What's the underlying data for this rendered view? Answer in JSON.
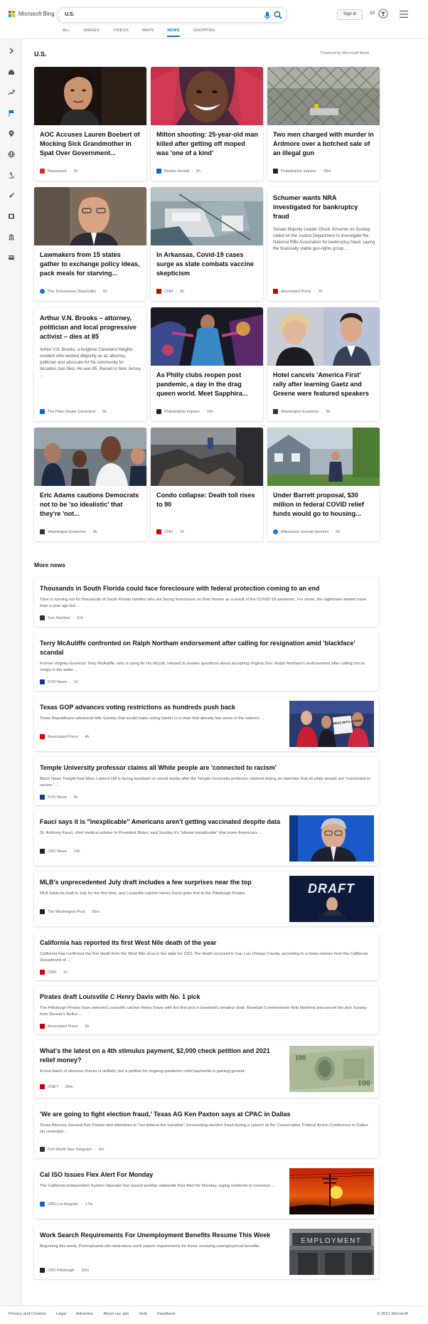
{
  "header": {
    "logo_text": "Microsoft Bing",
    "search_value": "U.S.",
    "signin_label": "Sign in",
    "reward_points": "10",
    "tabs": [
      "ALL",
      "IMAGES",
      "VIDEOS",
      "MAPS",
      "NEWS",
      "SHOPPING"
    ],
    "active_tab": "NEWS"
  },
  "sidebar": {
    "icons": [
      "expand-arrow-icon",
      "home-icon",
      "trending-icon",
      "flag-icon",
      "location-pin-icon",
      "globe-icon",
      "microscope-icon",
      "rocket-icon",
      "film-icon",
      "bank-icon",
      "credit-card-icon"
    ]
  },
  "section": {
    "title": "U.S.",
    "powered_by": "Powered by Microsoft News"
  },
  "top_stories": [
    {
      "title": "AOC Accuses Lauren Boebert of Mocking Sick Grandmother in Spat Over Government...",
      "source": "Newsweek",
      "time": "3h",
      "source_color": "#d32f2f"
    },
    {
      "title": "Milton shooting: 25-year-old man killed after getting off moped was 'one of a kind'",
      "source": "Boston Herald",
      "time": "2h",
      "source_color": "#1565c0"
    },
    {
      "title": "Two men charged with murder in Ardmore over a botched sale of an illegal gun",
      "source": "Philadelphia Inquirer",
      "time": "35m",
      "source_color": "#222222"
    },
    {
      "title": "Lawmakers from 15 states gather to exchange policy ideas, pack meals for starving...",
      "source": "The Tennessean (Nashville)",
      "time": "6h",
      "source_color": "#1976d2"
    },
    {
      "title": "In Arkansas, Covid-19 cases surge as state combats vaccine skepticism",
      "source": "CNN",
      "time": "2h",
      "source_color": "#cc0000"
    },
    {
      "title": "Schumer wants NRA investigated for bankruptcy fraud",
      "summary": "Senate Majority Leader Chuck Schumer on Sunday called on the Justice Department to investigate the National Rifle Association for bankruptcy fraud, saying the financially stable gun-rights group ...",
      "source": "Associated Press",
      "time": "7h",
      "source_color": "#cc0000"
    },
    {
      "title": "Arthur V.N. Brooks – attorney, politician and local progressive activist – dies at 85",
      "summary": "Arthur V.N. Brooks, a longtime Cleveland Heights resident who worked diligently as an attorney, politician and advocate for his community for decades, has died. He was 85. Raised in New Jersey, ...",
      "source": "The Plain Dealer Cleveland",
      "time": "5h",
      "source_color": "#1565c0"
    },
    {
      "title": "As Philly clubs reopen post pandemic, a day in the drag queen world. Meet Sapphira...",
      "source": "Philadelphia Inquirer",
      "time": "16h",
      "source_color": "#222222"
    },
    {
      "title": "Hotel cancels 'America First' rally after learning Gaetz and Greene were featured speakers",
      "source": "Washington Examiner",
      "time": "5h",
      "source_color": "#333333"
    },
    {
      "title": "Eric Adams cautions Democrats not to be 'so idealistic' that they're 'not...",
      "source": "Washington Examiner",
      "time": "9h",
      "source_color": "#333333"
    },
    {
      "title": "Condo collapse: Death toll rises to 90",
      "source": "CNN",
      "time": "7h",
      "source_color": "#cc0000"
    },
    {
      "title": "Under Barrett proposal, $30 million in federal COVID relief funds would go to housing...",
      "source": "Milwaukee Journal-Sentinel",
      "time": "3h",
      "source_color": "#1976d2"
    }
  ],
  "more_news": {
    "title": "More news",
    "items": [
      {
        "title": "Thousands in South Florida could face foreclosure with federal protection coming to an end",
        "summary": "Time is running out for thousands of South Florida families who are facing foreclosure on their homes as a result of the COVID-19 pandemic. For some, the nightmare started more than a year ago but ...",
        "source": "Sun Sentinel",
        "time": "11h",
        "source_color": "#333333"
      },
      {
        "title": "Terry McAuliffe confronted on Ralph Northam endorsement after calling for resignation amid 'blackface' scandal",
        "summary": "Former Virginia Governor Terry McAuliffe, who is vying for his old job, refused to answer questions about accepting Virginia Gov. Ralph Northam's endorsement after calling him to resign in the wake ...",
        "source": "FOX News",
        "time": "1h",
        "source_color": "#1a3a8a"
      },
      {
        "title": "Texas GOP advances voting restrictions as hundreds push back",
        "summary": "Texas Republicans advanced bills Sunday that would make voting harder in a state that already has some of the nation's ...",
        "source": "Associated Press",
        "time": "4h",
        "source_color": "#cc0000"
      },
      {
        "title": "Temple University professor claims all White people are 'connected to racism'",
        "summary": "Black News Tonight host Marc Lamont Hill is facing backlash on social media after the Temple University professor claimed during an interview that all white people are \"connected to racism.\" ...",
        "source": "FOX News",
        "time": "4h",
        "source_color": "#1a3a8a"
      },
      {
        "title": "Fauci says it is \"inexplicable\" Americans aren't getting vaccinated despite data",
        "summary": "Dr. Anthony Fauci, chief medical adviser to President Biden, said Sunday it's \"almost inexplicable\" that some Americans ...",
        "source": "CBS News",
        "time": "10h",
        "source_color": "#222222"
      },
      {
        "title": "MLB's unprecedented July draft includes a few surprises near the top",
        "summary": "MLB holds its draft in July for the first time, and Louisville catcher Henry Davis goes first to the Pittsburgh Pirates.",
        "source": "The Washington Post",
        "time": "50m",
        "source_color": "#222222"
      },
      {
        "title": "California has reported its first West Nile death of the year",
        "summary": "California has confirmed the first death from the West Nile virus in the state for 2021.The death occurred in San Luis Obispo County, according to a news release from the California Department of ...",
        "source": "CNN",
        "time": "1h",
        "source_color": "#cc0000"
      },
      {
        "title": "Pirates draft Louisville C Henry Davis with No. 1 pick",
        "summary": "The Pittsburgh Pirates have selected Louisville catcher Henry Davis with the first pick in baseball's amateur draft. Baseball Commissioner Rob Manfred announced the pick Sunday from Denver's Bellco ...",
        "source": "Associated Press",
        "time": "2h",
        "source_color": "#cc0000"
      },
      {
        "title": "What's the latest on a 4th stimulus payment, $2,000 check petition and 2021 relief money?",
        "summary": "A new batch of stimulus checks is unlikely, but a petition for ongoing pandemic relief payments is gaining ground.",
        "source": "CNET",
        "time": "29m",
        "source_color": "#cc0000"
      },
      {
        "title": "'We are going to fight election fraud,' Texas AG Ken Paxton says at CPAC in Dallas",
        "summary": "Texas Attorney General Ken Paxton told attendees to \"not believe the narrative\" surrounding election fraud during a speech at the Conservative Political Action Conference in Dallas. He reminded ...",
        "source": "Fort Worth Star-Telegram",
        "time": "6m",
        "source_color": "#333333"
      },
      {
        "title": "Cal ISO Issues Flex Alert For Monday",
        "summary": "The California Independent System Operator has issued another statewide Flex Alert for Monday, urging residents to conserve ...",
        "source": "CBS Los Angeles",
        "time": "17m",
        "source_color": "#1565c0"
      },
      {
        "title": "Work Search Requirements For Unemployment Benefits Resume This Week",
        "summary": "Beginning this week, Pennsylvania will reintroduce work search requirements for those receiving unemployment benefits.",
        "source": "CBS Pittsburgh",
        "time": "33m",
        "source_color": "#222222"
      }
    ]
  },
  "images": {
    "donot_sign_text": "DON'T MESS WITH VOTING",
    "draft_sign_text": "DRAFT",
    "employment_sign_text": "EMPLOYMENT"
  },
  "footer": {
    "links": [
      "Privacy and Cookies",
      "Legal",
      "Advertise",
      "About our ads",
      "Help",
      "Feedback"
    ],
    "copyright": "© 2021 Microsoft"
  }
}
